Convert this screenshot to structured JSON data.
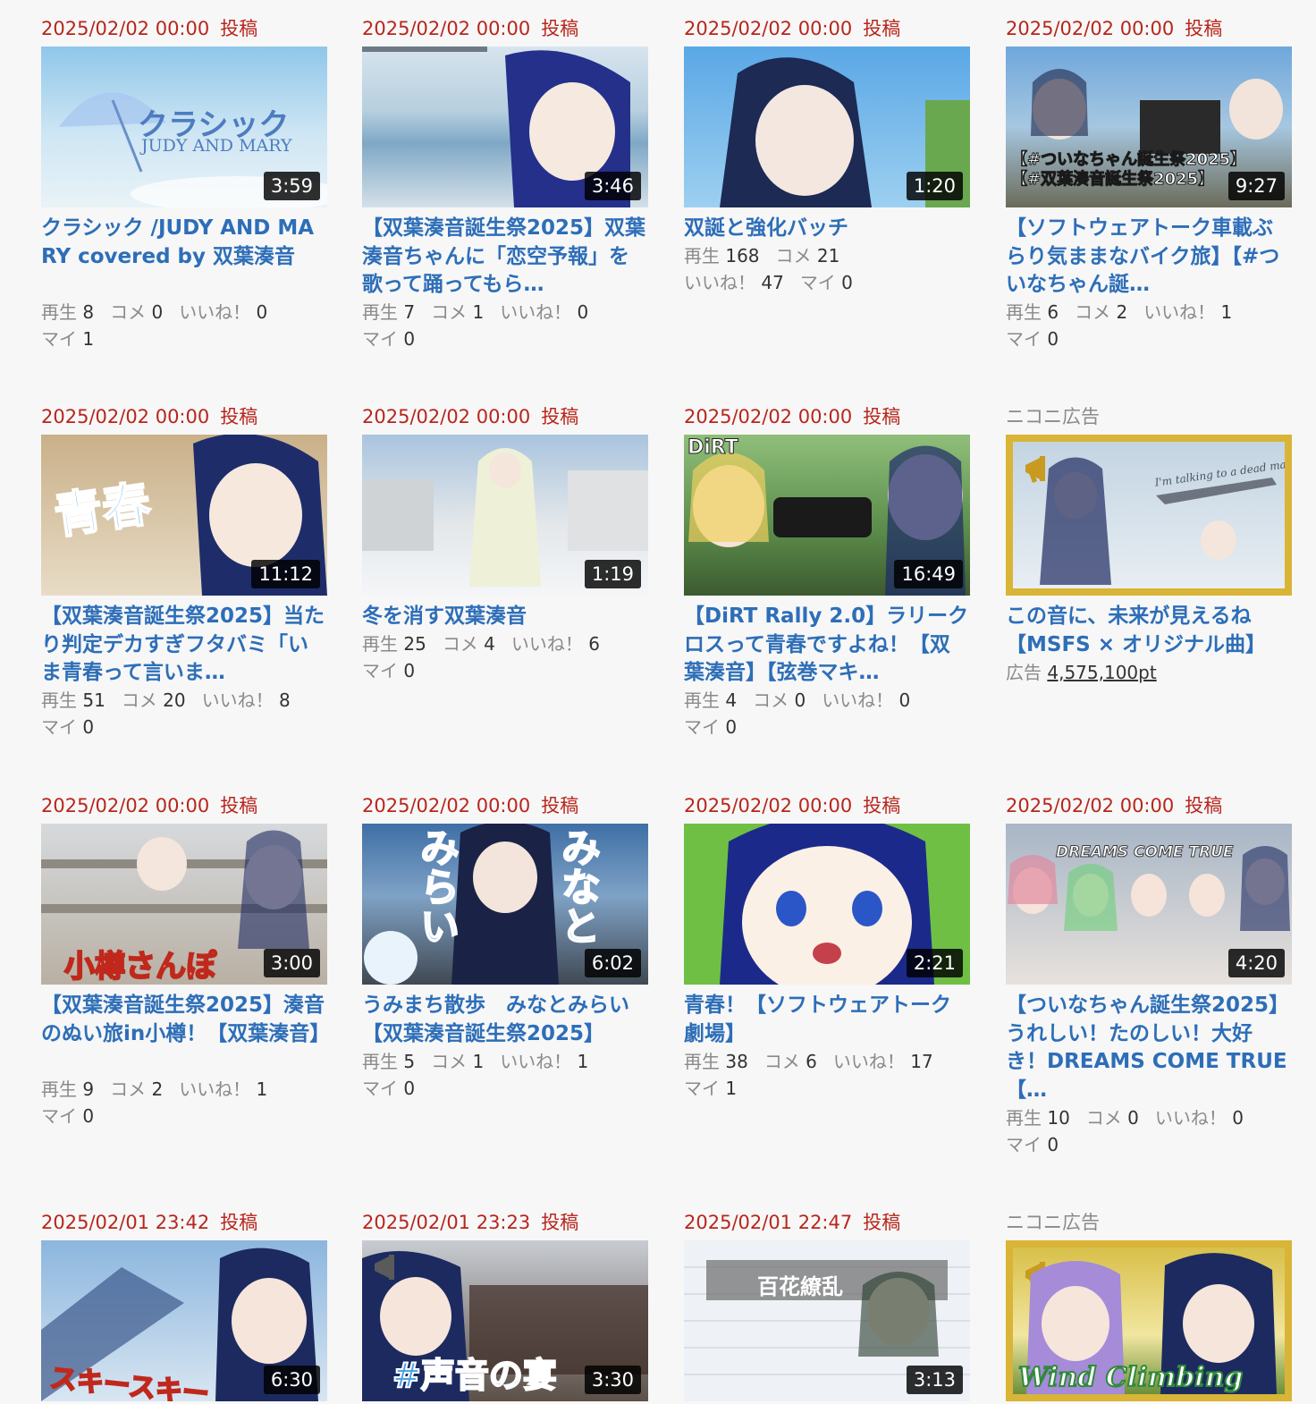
{
  "labels": {
    "posted": "投稿",
    "views": "再生",
    "comments": "コメ",
    "likes": "いいね！",
    "mylist": "マイ",
    "ad_header": "ニコニ広告",
    "ad_label": "広告"
  },
  "videos": [
    {
      "date": "2025/02/02 00:00",
      "duration": "3:59",
      "title": "クラシック /JUDY AND MARY covered by 双葉湊音",
      "views": "8",
      "comments": "0",
      "likes": "0",
      "mylist": "1",
      "thumb_text_1": "クラシック",
      "thumb_text_2": "JUDY AND MARY"
    },
    {
      "date": "2025/02/02 00:00",
      "duration": "3:46",
      "title": "【双葉湊音誕生祭2025】双葉湊音ちゃんに「恋空予報」を歌って踊ってもら…",
      "views": "7",
      "comments": "1",
      "likes": "0",
      "mylist": "0"
    },
    {
      "date": "2025/02/02 00:00",
      "duration": "1:20",
      "title": "双誕と強化バッチ",
      "views": "168",
      "comments": "21",
      "likes": "47",
      "mylist": "0"
    },
    {
      "date": "2025/02/02 00:00",
      "duration": "9:27",
      "title": "【ソフトウェアトーク車載ぶらり気ままなバイク旅】【#ついなちゃん誕…",
      "views": "6",
      "comments": "2",
      "likes": "1",
      "mylist": "0",
      "thumb_text_1": "【#ついなちゃん誕生祭2025】",
      "thumb_text_2": "【#双葉湊音誕生祭2025】"
    },
    {
      "date": "2025/02/02 00:00",
      "duration": "11:12",
      "title": "【双葉湊音誕生祭2025】当たり判定デカすぎフタバミ「いま青春って言いま…",
      "views": "51",
      "comments": "20",
      "likes": "8",
      "mylist": "0",
      "thumb_text_1": "青春"
    },
    {
      "date": "2025/02/02 00:00",
      "duration": "1:19",
      "title": "冬を消す双葉湊音",
      "views": "25",
      "comments": "4",
      "likes": "6",
      "mylist": "0"
    },
    {
      "date": "2025/02/02 00:00",
      "duration": "16:49",
      "title": "【DiRT Rally 2.0】ラリークロスって青春ですよね！【双葉湊音】【弦巻マキ…",
      "views": "4",
      "comments": "0",
      "likes": "0",
      "mylist": "0",
      "thumb_text_1": "DiRT"
    },
    {
      "date": "2025/02/02 00:00",
      "duration": "3:00",
      "title": "【双葉湊音誕生祭2025】湊音のぬい旅in小樽！【双葉湊音】",
      "views": "9",
      "comments": "2",
      "likes": "1",
      "mylist": "0",
      "thumb_text_1": "小樽さんぽ"
    },
    {
      "date": "2025/02/02 00:00",
      "duration": "6:02",
      "title": "うみまち散歩　みなとみらい【双葉湊音誕生祭2025】",
      "views": "5",
      "comments": "1",
      "likes": "1",
      "mylist": "0",
      "thumb_text_1": "みなと",
      "thumb_text_2": "みらい"
    },
    {
      "date": "2025/02/02 00:00",
      "duration": "2:21",
      "title": "青春！【ソフトウェアトーク劇場】",
      "views": "38",
      "comments": "6",
      "likes": "17",
      "mylist": "1"
    },
    {
      "date": "2025/02/02 00:00",
      "duration": "4:20",
      "title": "【ついなちゃん誕生祭2025】うれしい！たのしい！大好き！DREAMS COME TRUE【…",
      "views": "10",
      "comments": "0",
      "likes": "0",
      "mylist": "0",
      "thumb_text_1": "DREAMS COME TRUE"
    },
    {
      "date": "2025/02/01 23:42",
      "duration": "6:30",
      "title": "",
      "thumb_text_1": "スキースキー"
    },
    {
      "date": "2025/02/01 23:23",
      "duration": "3:30",
      "title": "",
      "thumb_text_1": "#声音の宴"
    },
    {
      "date": "2025/02/01 22:47",
      "duration": "3:13",
      "title": "",
      "thumb_text_1": "百花繚乱"
    }
  ],
  "ads": [
    {
      "title": "この音に、未来が見えるね【MSFS × オリジナル曲】",
      "points": "4,575,100pt",
      "thumb_text_1": "I'm talking to a dead man"
    },
    {
      "title": "",
      "thumb_text_1": "Wind Climbing"
    }
  ],
  "colors": {
    "date_red": "#b8261c",
    "title_blue": "#2d6eb8",
    "ad_gold": "#d9b436"
  }
}
